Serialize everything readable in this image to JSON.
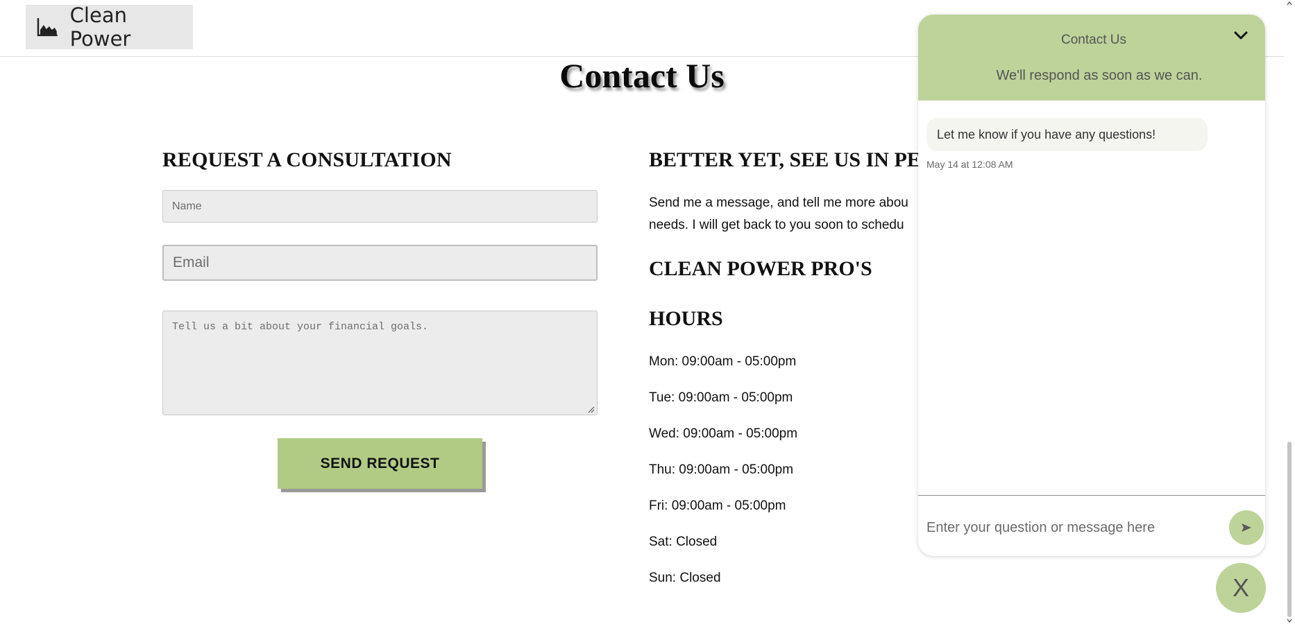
{
  "header": {
    "brand_name": "Clean Power",
    "brand_icon": "area-chart-icon"
  },
  "page": {
    "title": "Contact Us"
  },
  "form": {
    "heading": "REQUEST A CONSULTATION",
    "name_placeholder": "Name",
    "email_placeholder": "Email",
    "message_placeholder": "Tell us a bit about your financial goals.",
    "submit_label": "SEND REQUEST"
  },
  "info": {
    "visit_heading": "BETTER YET, SEE US IN PER",
    "intro_line1": "Send me a message, and tell me more abou",
    "intro_line2": "needs. I will get back to you soon to schedu",
    "company_heading": "CLEAN POWER PRO'S",
    "hours_heading": "HOURS",
    "hours": [
      "Mon: 09:00am - 05:00pm",
      "Tue: 09:00am - 05:00pm",
      "Wed: 09:00am - 05:00pm",
      "Thu: 09:00am - 05:00pm",
      "Fri: 09:00am - 05:00pm",
      "Sat: Closed",
      "Sun: Closed"
    ]
  },
  "chat": {
    "title": "Contact Us",
    "subtitle": "We'll respond as soon as we can.",
    "message": "Let me know if you have any questions!",
    "timestamp": "May 14 at 12:08 AM",
    "input_placeholder": "Enter your question or message here",
    "close_label": "X"
  },
  "colors": {
    "accent": "#b1cb84",
    "chat_header": "#bdd39a",
    "field_bg": "#ececec"
  }
}
